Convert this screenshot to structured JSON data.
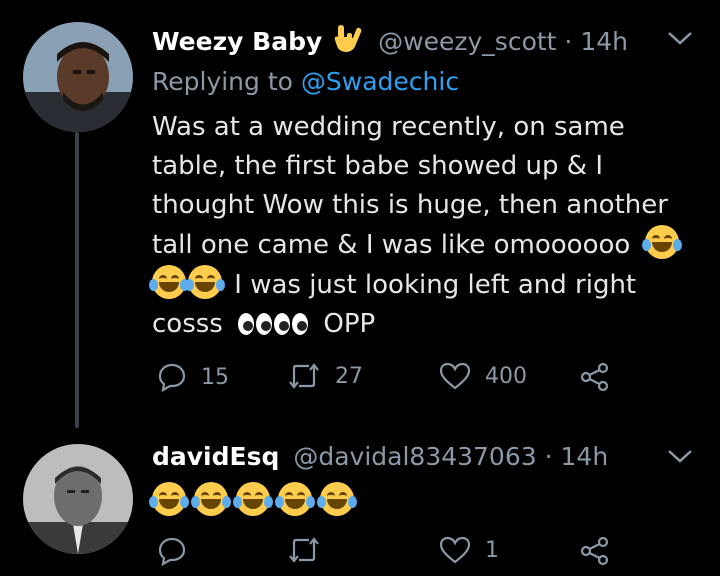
{
  "tweets": [
    {
      "name": "Weezy Baby",
      "handle": "@weezy_scott",
      "separator": "·",
      "time": "14h",
      "replying_prefix": "Replying to",
      "replying_to": "@Swadechic",
      "body_lines": [
        "Was at a wedding recently, on same",
        "table, the first babe showed up & I",
        "thought Wow this is huge, then another",
        "tall one came & I was like omoooooo",
        "I was just looking left and right",
        "cosss",
        "OPP"
      ],
      "actions": {
        "replies": "15",
        "retweets": "27",
        "likes": "400"
      }
    },
    {
      "name": "davidEsq",
      "handle": "@davidal83437063",
      "separator": "·",
      "time": "14h",
      "actions": {
        "replies": "",
        "retweets": "",
        "likes": "1"
      }
    }
  ],
  "colors": {
    "background": "#000000",
    "muted": "#8b98a5",
    "link": "#2ea0f0",
    "text": "#e6e6e6"
  },
  "icons": [
    "rock-on-hand-icon",
    "chevron-down-icon",
    "laughing-emoji-icon",
    "eyes-emoji-icon",
    "reply-icon",
    "retweet-icon",
    "like-icon",
    "share-icon"
  ]
}
